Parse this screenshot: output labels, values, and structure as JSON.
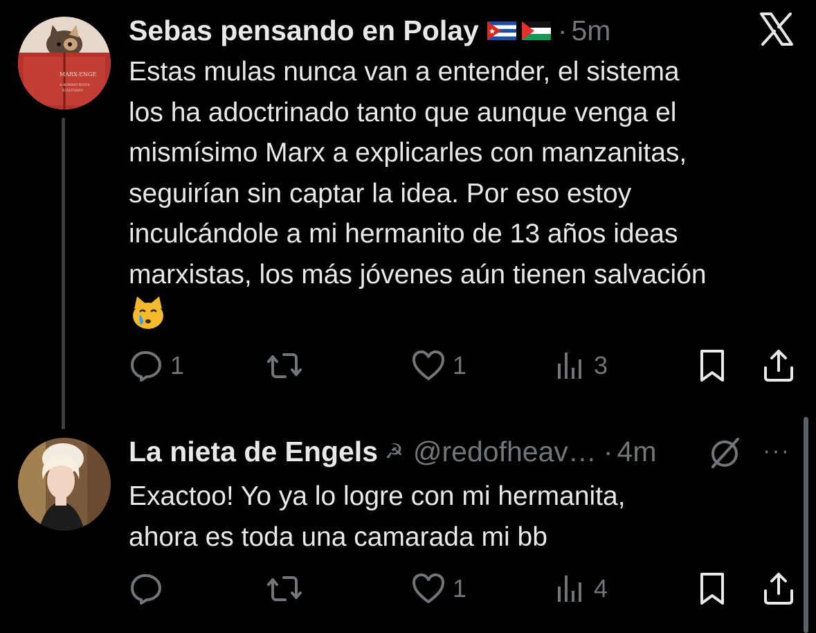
{
  "tweet1": {
    "display_name": "Sebas pensando en Polay",
    "flags": [
      "cuba-flag-icon",
      "palestine-flag-icon"
    ],
    "time": "5m",
    "text": "Estas mulas nunca van a entender, el sistema\nlos ha adoctrinado tanto que aunque venga el\nmismísimo Marx a explicarles con manzanitas,\nseguirían sin captar la idea. Por eso estoy\ninculcándole a mi hermanito de 13 años ideas\nmarxistas, los más jóvenes aún tienen salvación",
    "emoji": "crying-cat-icon",
    "avatar_book_text": [
      "MARX-ENGE",
      "A KOMMUNISTA",
      "KIÁLTVÁNY"
    ],
    "reply_count": "1",
    "retweet_count": "",
    "like_count": "1",
    "view_count": "3"
  },
  "tweet2": {
    "display_name": "La nieta de Engels",
    "name_symbol": "☭",
    "handle": "@redofheav…",
    "time": "4m",
    "text": "Exactoo! Yo ya lo logre con mi hermanita,\nahora es toda una camarada mi bb",
    "reply_count": "",
    "retweet_count": "",
    "like_count": "1",
    "view_count": "4",
    "more_label": "···"
  },
  "colors": {
    "background": "#000000",
    "text": "#e7e9ea",
    "muted": "#71767b",
    "thread_line": "#3b3f43"
  }
}
